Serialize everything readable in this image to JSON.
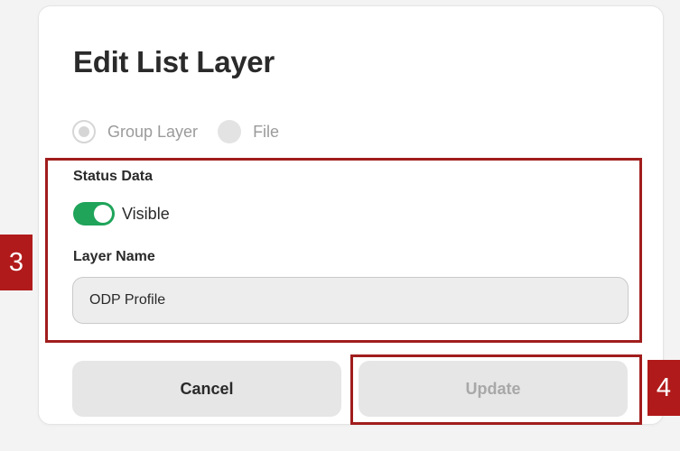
{
  "dialog": {
    "title": "Edit List Layer",
    "layer_type_options": [
      {
        "label": "Group Layer",
        "selected": true
      },
      {
        "label": "File",
        "selected": false
      }
    ],
    "status_label": "Status Data",
    "visible_toggle": {
      "label": "Visible",
      "on": true
    },
    "layer_name_label": "Layer Name",
    "layer_name_value": "ODP Profile",
    "cancel_label": "Cancel",
    "update_label": "Update"
  },
  "annotations": {
    "marker_3": "3",
    "marker_4": "4",
    "highlight_color": "#a11d1d"
  },
  "colors": {
    "toggle_on": "#1fa45a",
    "button_bg": "#e6e6e6",
    "disabled_text": "#a8a8a8"
  }
}
